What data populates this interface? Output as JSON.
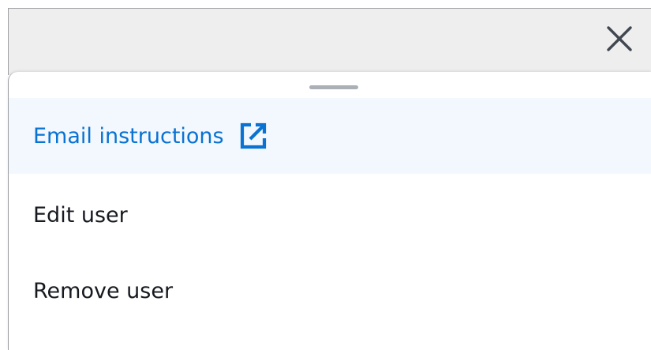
{
  "header": {
    "close_icon": "close-icon"
  },
  "sheet": {
    "drag_handle_icon": "drag-handle",
    "menu": {
      "items": [
        {
          "label": "Email instructions",
          "icon": "external-link-icon",
          "active": true
        },
        {
          "label": "Edit user"
        },
        {
          "label": "Remove user"
        }
      ]
    }
  },
  "colors": {
    "accent": "#0972d3",
    "active_background": "#f2f8fd",
    "header_background": "#eeeeef",
    "text": "#16191f"
  }
}
